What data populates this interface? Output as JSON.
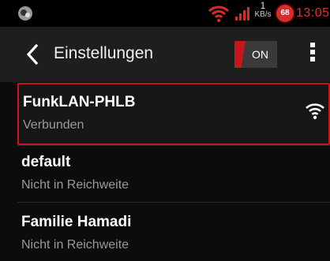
{
  "statusbar": {
    "speed_value": "1",
    "speed_unit": "KB/s",
    "battery": "68",
    "time": "13:05"
  },
  "actionbar": {
    "title": "Einstellungen",
    "toggle_label": "ON"
  },
  "networks": [
    {
      "name": "FunkLAN-PHLB",
      "status": "Verbunden"
    },
    {
      "name": "default",
      "status": "Nicht in Reichweite"
    },
    {
      "name": "Familie Hamadi",
      "status": "Nicht in Reichweite"
    }
  ],
  "colors": {
    "accent": "#c8161d",
    "background": "#0c0c0c"
  }
}
